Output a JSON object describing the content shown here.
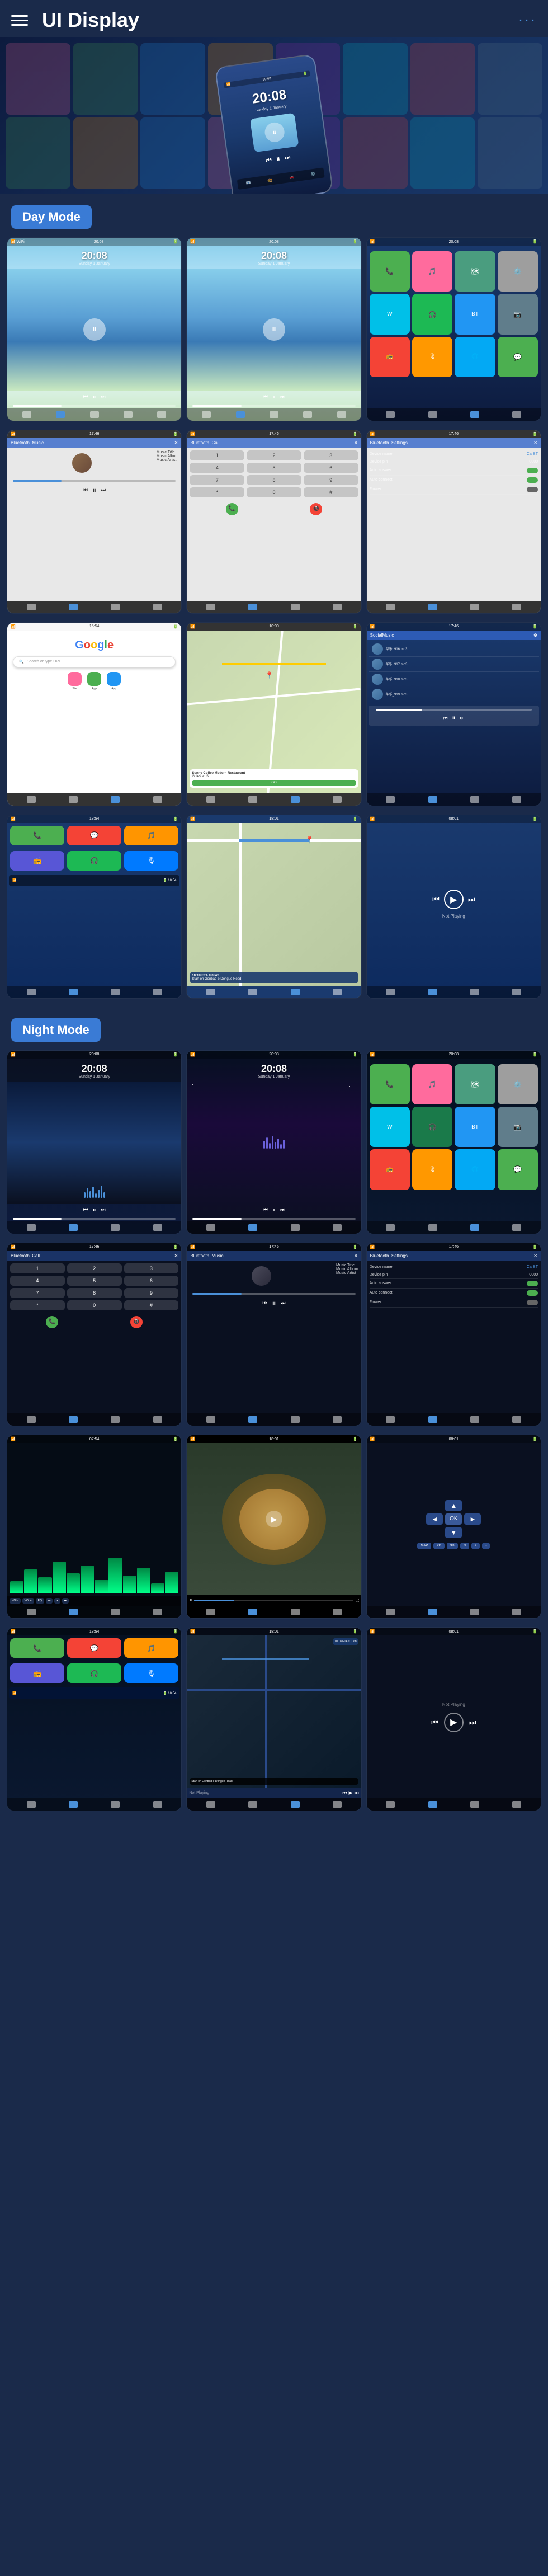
{
  "header": {
    "title": "UI Display",
    "menu_label": "menu",
    "dots_label": "···"
  },
  "day_mode": {
    "label": "Day Mode"
  },
  "night_mode": {
    "label": "Night Mode"
  },
  "screens": {
    "time": "20:08",
    "time_sub": "Sunday 1 January",
    "bluetooth_music": "Bluetooth_Music",
    "bluetooth_call": "Bluetooth_Call",
    "bluetooth_settings": "Bluetooth_Settings",
    "music_title": "Music Title",
    "music_album": "Music Album",
    "music_artist": "Music Artist",
    "device_name_label": "Device name",
    "device_name_val": "CarBT",
    "device_pin_label": "Device pin",
    "device_pin_val": "0000",
    "auto_answer_label": "Auto answer",
    "auto_connect_label": "Auto connect",
    "flower_label": "Flower",
    "social_music_label": "SocialMusic",
    "google_text": "Google",
    "search_placeholder": "Search or type URL",
    "coffee_shop": "Sunny Coffee Modern Restaurant",
    "coffee_addr": "Golestan St.",
    "eta_label": "10:18 ETA  9.0 km",
    "go_button": "GO",
    "nav_start": "Start on Gonbad-e Dongue Road",
    "not_playing": "Not Playing"
  }
}
